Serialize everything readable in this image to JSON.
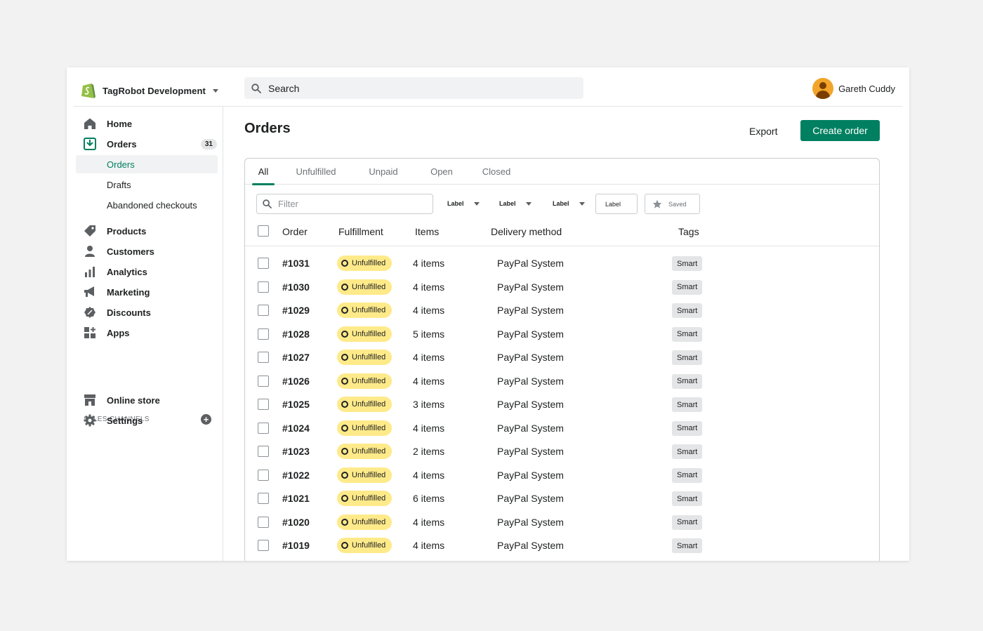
{
  "store": {
    "name": "TagRobot  Development"
  },
  "search": {
    "label": "Search"
  },
  "user": {
    "name": "Gareth Cuddy"
  },
  "sidebar": {
    "home": "Home",
    "orders": "Orders",
    "orders_count": "31",
    "orders_sub": [
      "Orders",
      "Drafts",
      "Abandoned checkouts"
    ],
    "products": "Products",
    "customers": "Customers",
    "analytics": "Analytics",
    "marketing": "Marketing",
    "discounts": "Discounts",
    "apps": "Apps",
    "sales_channels_label": "SALES CHANNELS",
    "online_store": "Online store",
    "settings": "Settings"
  },
  "page": {
    "title": "Orders",
    "export_label": "Export",
    "create_label": "Create order"
  },
  "tabs": [
    "All",
    "Unfulfilled",
    "Unpaid",
    "Open",
    "Closed"
  ],
  "filters": {
    "placeholder": "Filter",
    "dropdowns": [
      "Label",
      "Label",
      "Label"
    ],
    "label_box": "Label",
    "saved": "Saved"
  },
  "table": {
    "headers": {
      "order": "Order",
      "fulfillment": "Fulfillment",
      "items": "Items",
      "delivery": "Delivery method",
      "tags": "Tags"
    },
    "rows": [
      {
        "order": "#1031",
        "status": "Unfulfilled",
        "items": "4 items",
        "delivery": "PayPal System",
        "tag": "Smart"
      },
      {
        "order": "#1030",
        "status": "Unfulfilled",
        "items": "4 items",
        "delivery": "PayPal System",
        "tag": "Smart"
      },
      {
        "order": "#1029",
        "status": "Unfulfilled",
        "items": "4 items",
        "delivery": "PayPal System",
        "tag": "Smart"
      },
      {
        "order": "#1028",
        "status": "Unfulfilled",
        "items": "5 items",
        "delivery": "PayPal System",
        "tag": "Smart"
      },
      {
        "order": "#1027",
        "status": "Unfulfilled",
        "items": "4 items",
        "delivery": "PayPal System",
        "tag": "Smart"
      },
      {
        "order": "#1026",
        "status": "Unfulfilled",
        "items": "4 items",
        "delivery": "PayPal System",
        "tag": "Smart"
      },
      {
        "order": "#1025",
        "status": "Unfulfilled",
        "items": "3 items",
        "delivery": "PayPal System",
        "tag": "Smart"
      },
      {
        "order": "#1024",
        "status": "Unfulfilled",
        "items": "4 items",
        "delivery": "PayPal System",
        "tag": "Smart"
      },
      {
        "order": "#1023",
        "status": "Unfulfilled",
        "items": "2 items",
        "delivery": "PayPal System",
        "tag": "Smart"
      },
      {
        "order": "#1022",
        "status": "Unfulfilled",
        "items": "4 items",
        "delivery": "PayPal System",
        "tag": "Smart"
      },
      {
        "order": "#1021",
        "status": "Unfulfilled",
        "items": "6 items",
        "delivery": "PayPal System",
        "tag": "Smart"
      },
      {
        "order": "#1020",
        "status": "Unfulfilled",
        "items": "4 items",
        "delivery": "PayPal System",
        "tag": "Smart"
      },
      {
        "order": "#1019",
        "status": "Unfulfilled",
        "items": "4 items",
        "delivery": "PayPal System",
        "tag": "Smart"
      }
    ]
  },
  "colors": {
    "brand_green": "#008060",
    "active_nav": "#007f5f",
    "status_yellow": "#ffea8a"
  }
}
